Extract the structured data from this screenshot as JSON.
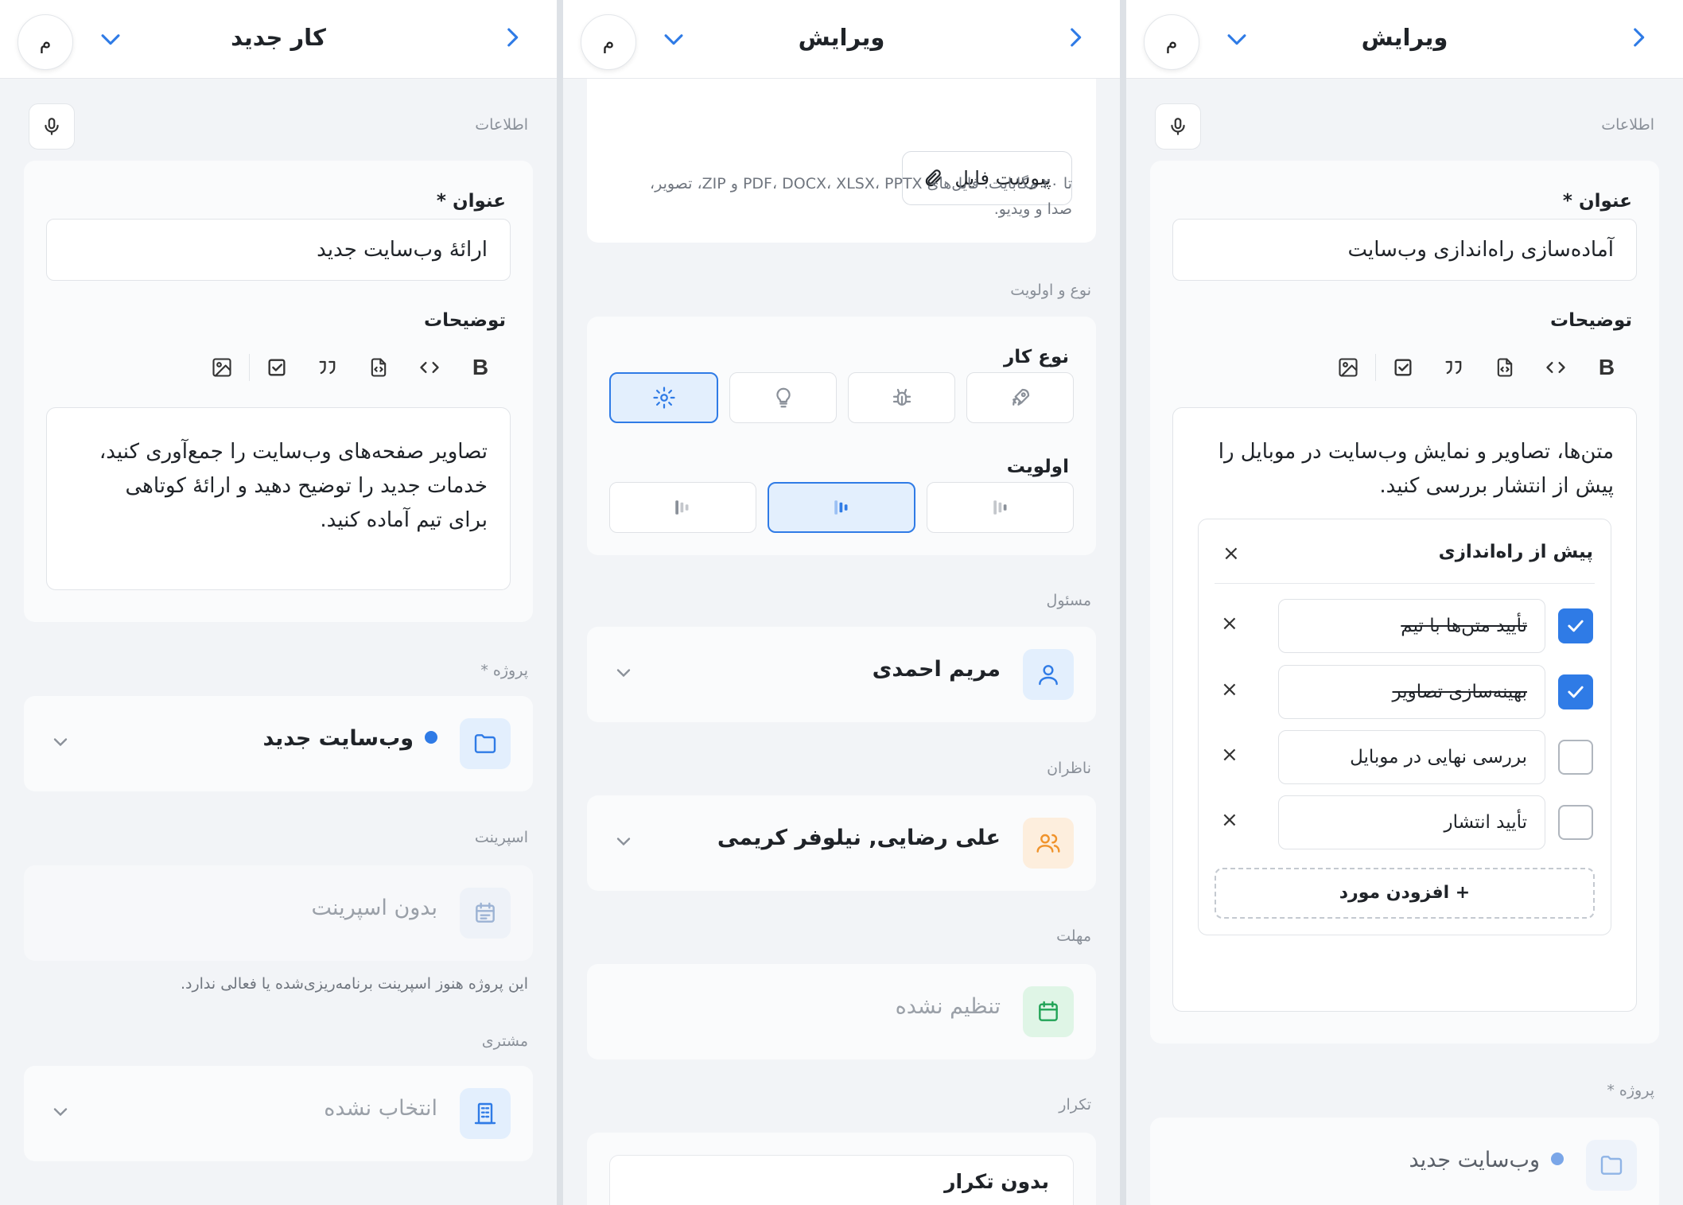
{
  "panel1": {
    "title": "کار جدید",
    "avatar": "م",
    "info_label": "اطلاعات",
    "title_label": "عنوان *",
    "title_value": "ارائهٔ وب‌سایت جدید",
    "desc_label": "توضیحات",
    "toolbar_bold": "B",
    "desc_lines": [
      "تصاویر صفحه‌های وب‌سایت را جمع‌آوری کنید،",
      "خدمات جدید را توضیح دهید و ارائهٔ کوتاهی",
      "برای تیم آماده کنید."
    ],
    "project_label": "پروژه *",
    "project_value": "وب‌سایت جدید",
    "sprint_label": "اسپرینت",
    "sprint_value": "بدون اسپرینت",
    "sprint_hint": "این پروژه هنوز اسپرینت برنامه‌ریزی‌شده یا فعالی ندارد.",
    "customer_label": "مشتری",
    "customer_value": "انتخاب نشده"
  },
  "panel2": {
    "title": "ویرایش",
    "avatar": "م",
    "attach_label": "پیوست فایل",
    "attach_hint_1": "تا ۲۰ مگابایت. فایل‌های PDF، DOCX، XLSX، PPTX و ZIP، تصویر،",
    "attach_hint_2": "صدا و ویدیو.",
    "type_section": "نوع و اولویت",
    "type_label": "نوع کار",
    "priority_label": "اولویت",
    "assignee_label": "مسئول",
    "assignee_value": "مریم احمدی",
    "watchers_label": "ناظران",
    "watchers_value": "علی رضایی, نیلوفر کریمی",
    "deadline_label": "مهلت",
    "deadline_value": "تنظیم نشده",
    "repeat_label": "تکرار",
    "repeat_value": "بدون تکرار"
  },
  "panel3": {
    "title": "ویرایش",
    "avatar": "م",
    "info_label": "اطلاعات",
    "title_label": "عنوان *",
    "title_value": "آماده‌سازی راه‌اندازی وب‌سایت",
    "desc_label": "توضیحات",
    "toolbar_bold": "B",
    "desc_lines": [
      "متن‌ها، تصاویر و نمایش وب‌سایت در موبایل را",
      "پیش از انتشار بررسی کنید."
    ],
    "checklist_title": "پیش از راه‌اندازی",
    "checklist": [
      {
        "text": "تأیید متن‌ها با تیم",
        "done": true
      },
      {
        "text": "بهینه‌سازی تصاویر",
        "done": true
      },
      {
        "text": "بررسی نهایی در موبایل",
        "done": false
      },
      {
        "text": "تأیید انتشار",
        "done": false
      }
    ],
    "add_item": "+ افزودن مورد",
    "project_label": "پروژه *",
    "project_value": "وب‌سایت جدید",
    "close_glyph": "×"
  },
  "colors": {
    "accent": "#2f7be6",
    "assignee_bg": "#e3effd",
    "watchers_bg": "#fdeedd",
    "deadline_bg": "#dff5e6"
  }
}
